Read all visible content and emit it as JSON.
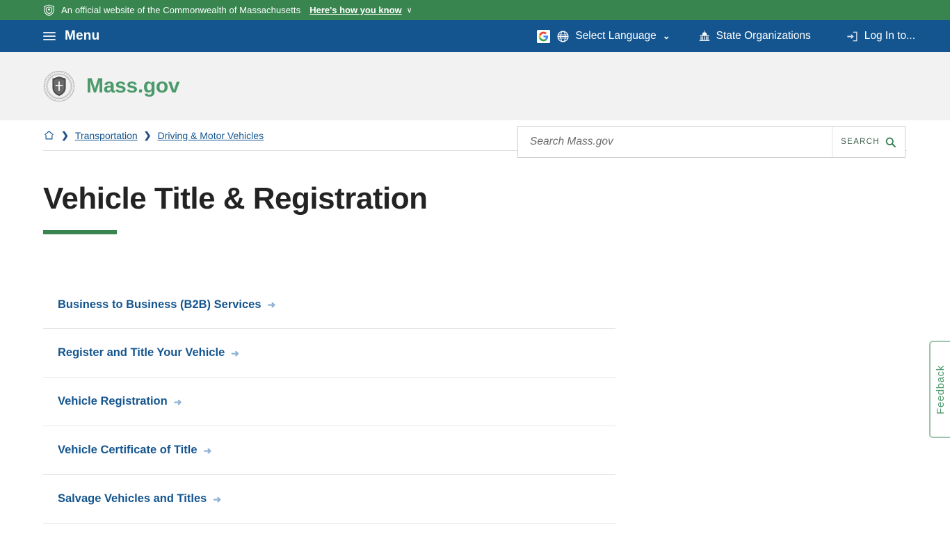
{
  "gov_banner": {
    "icon": "shield-seal-icon",
    "text": "An official website of the Commonwealth of Massachusetts",
    "how_you_know_label": "Here's how you know",
    "chevron": "∨",
    "background": "#388550"
  },
  "main_nav": {
    "background": "#14558f",
    "menu_label": "Menu",
    "menu_icon": "hamburger-icon",
    "items": [
      {
        "icon": "google-translate-icon",
        "label": "Select Language",
        "chevron": "⌄"
      },
      {
        "icon": "capitol-building-icon",
        "label": "State Organizations"
      },
      {
        "icon": "login-arrow-icon",
        "label": "Log In to..."
      }
    ]
  },
  "header": {
    "logo_icon": "massachusetts-state-seal",
    "logo_text": "Mass.gov",
    "logo_color": "#4c9a6b",
    "background": "#f2f2f2"
  },
  "search": {
    "placeholder": "Search Mass.gov",
    "value": "",
    "button_label": "SEARCH",
    "button_icon": "magnifier-icon",
    "icon_color": "#2e7d4f"
  },
  "breadcrumb": {
    "home_icon": "home-icon",
    "separator": "❯",
    "items": [
      {
        "label": "Transportation"
      },
      {
        "label": "Driving & Motor Vehicles"
      }
    ]
  },
  "page": {
    "title": "Vehicle Title & Registration",
    "accent_color": "#388550"
  },
  "links": {
    "arrow": "➜",
    "items": [
      {
        "label": "Business to Business (B2B) Services"
      },
      {
        "label": "Register and Title Your Vehicle"
      },
      {
        "label": "Vehicle Registration"
      },
      {
        "label": "Vehicle Certificate of Title"
      },
      {
        "label": "Salvage Vehicles and Titles"
      }
    ]
  },
  "feedback": {
    "label": "Feedback",
    "color": "#4c9a6b"
  }
}
